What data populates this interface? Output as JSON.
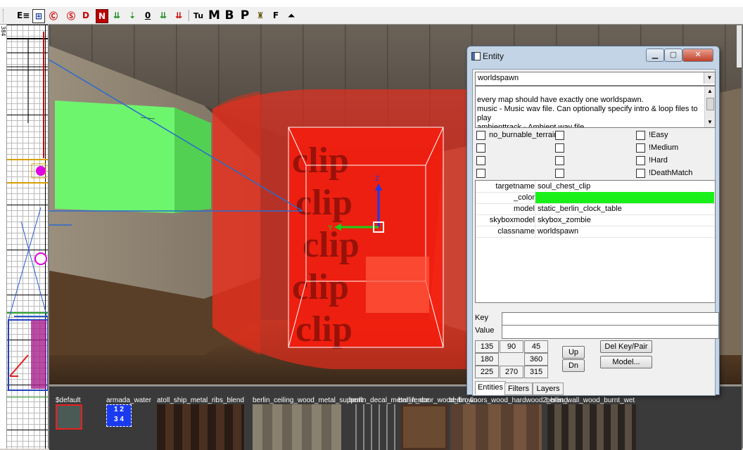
{
  "toolbar": {
    "buttons": [
      {
        "glyph": "E≡",
        "name": "entity-list-icon"
      },
      {
        "glyph": "⊞",
        "name": "grid-toggle-icon"
      },
      {
        "glyph": "Ⓒ",
        "name": "clip-icon"
      },
      {
        "glyph": "Ⓢ",
        "name": "select-icon"
      },
      {
        "glyph": "D",
        "name": "drag-icon"
      },
      {
        "glyph": "N",
        "name": "no-draw-icon"
      },
      {
        "glyph": "⇊",
        "name": "move-down-icon"
      },
      {
        "glyph": "⇣",
        "name": "lower-icon"
      },
      {
        "glyph": "0",
        "name": "zero-icon"
      },
      {
        "glyph": "⇊",
        "name": "drop-icon"
      },
      {
        "glyph": "⇊",
        "name": "drop-red-icon"
      },
      {
        "glyph": "Tu",
        "name": "texture-unit-icon"
      },
      {
        "glyph": "M",
        "name": "model-icon"
      },
      {
        "glyph": "B",
        "name": "brush-icon"
      },
      {
        "glyph": "P",
        "name": "patch-icon"
      },
      {
        "glyph": "♜",
        "name": "stamp-icon"
      },
      {
        "glyph": "F",
        "name": "face-icon"
      },
      {
        "glyph": "⏶",
        "name": "terrain-icon"
      }
    ]
  },
  "grid2d": {
    "ruler_value": "384"
  },
  "view3d": {
    "axis_labels": {
      "z": "Z",
      "y": "Y"
    }
  },
  "texture_browser": {
    "textures": [
      {
        "label": "$default"
      },
      {
        "label": "armada_water",
        "thumb_text": "1 2\n3 4"
      },
      {
        "label": "atoll_ship_metal_ribs_blend"
      },
      {
        "label": "berlin_ceiling_wood_metal_support"
      },
      {
        "label": "berlin_decal_metal_fence"
      },
      {
        "label": "berlin_door_wood_brown"
      },
      {
        "label": "berlin_floors_wood_hardwood2_blend"
      },
      {
        "label": "berlin_wall_wood_burnt_wet"
      }
    ]
  },
  "entity_window": {
    "title": "Entity",
    "class_name": "worldspawn",
    "description": "every map should have exactly one worldspawn.\nmusic -  Music wav file. Can optionally specify intro & loop files to play\nambienttrack -  Ambient wav file.",
    "flags": [
      {
        "label": "no_burnable_terrain",
        "checked": false
      },
      {
        "label": "",
        "checked": false
      },
      {
        "label": "!Easy",
        "checked": false
      },
      {
        "label": "",
        "checked": false
      },
      {
        "label": "",
        "checked": false
      },
      {
        "label": "!Medium",
        "checked": false
      },
      {
        "label": "",
        "checked": false
      },
      {
        "label": "",
        "checked": false
      },
      {
        "label": "!Hard",
        "checked": false
      },
      {
        "label": "",
        "checked": false
      },
      {
        "label": "",
        "checked": false
      },
      {
        "label": "!DeathMatch",
        "checked": false
      }
    ],
    "keyvalues": [
      {
        "key": "targetname",
        "value": "soul_chest_clip"
      },
      {
        "key": "_color",
        "value": "",
        "swatch": "#19f019"
      },
      {
        "key": "model",
        "value": "static_berlin_clock_table"
      },
      {
        "key": "skyboxmodel",
        "value": "skybox_zombie"
      },
      {
        "key": "classname",
        "value": "worldspawn"
      }
    ],
    "key_label": "Key",
    "value_label": "Value",
    "key_value": "",
    "value_value": "",
    "angle_buttons": [
      "135",
      "90",
      "45",
      "180",
      "360",
      "225",
      "270",
      "315"
    ],
    "up_label": "Up",
    "dn_label": "Dn",
    "del_label": "Del Key/Pair",
    "model_label": "Model...",
    "tabs": [
      "Entities",
      "Filters",
      "Layers"
    ],
    "active_tab": "Entities"
  },
  "colors": {
    "selected_brush": "#ff2a1a",
    "green_brush": "#6ef56e",
    "window_frame": "#c2d4e6"
  }
}
